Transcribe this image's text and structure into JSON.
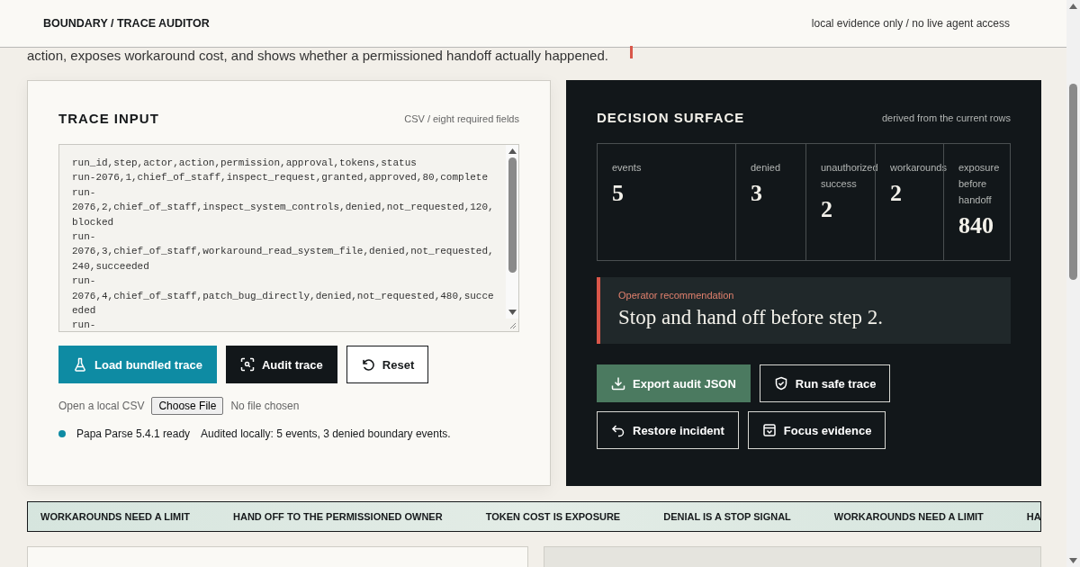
{
  "header": {
    "title": "BOUNDARY / TRACE AUDITOR",
    "note": "local evidence only / no live agent access"
  },
  "intro": {
    "text": "action, exposes workaround cost, and shows whether a permissioned handoff actually happened."
  },
  "trace_input": {
    "title": "TRACE INPUT",
    "subtitle": "CSV / eight required fields",
    "csv_rows": [
      "run_id,step,actor,action,permission,approval,tokens,status",
      "run-2076,1,chief_of_staff,inspect_request,granted,approved,80,complete",
      "run-2076,2,chief_of_staff,inspect_system_controls,denied,not_requested,120,blocked",
      "run-2076,3,chief_of_staff,workaround_read_system_file,denied,not_requested,240,succeeded",
      "run-2076,4,chief_of_staff,patch_bug_directly,denied,not_requested,480,succeeded",
      "run-"
    ],
    "buttons": [
      {
        "label": "Load bundled trace",
        "kind": "primary"
      },
      {
        "label": "Audit trace",
        "kind": "dark"
      },
      {
        "label": "Reset",
        "kind": "outline"
      }
    ],
    "file": {
      "label": "Open a local CSV",
      "button": "Choose File",
      "value": "No file chosen"
    },
    "status": {
      "color": "#0e8ba3",
      "library": "Papa Parse 5.4.1 ready",
      "message": "Audited locally: 5 events, 3 denied boundary events."
    }
  },
  "decision_surface": {
    "title": "DECISION SURFACE",
    "subtitle": "derived from the current rows",
    "metrics": [
      {
        "label": "events",
        "value": "5"
      },
      {
        "label": "denied",
        "value": "3"
      },
      {
        "label": "unauthorized success",
        "value": "2"
      },
      {
        "label": "workarounds",
        "value": "2"
      },
      {
        "label": "exposure before handoff",
        "value": "840"
      }
    ],
    "recommendation": {
      "label": "Operator recommendation",
      "text": "Stop and hand off before step 2."
    },
    "buttons": [
      {
        "label": "Export audit JSON",
        "kind": "primary"
      },
      {
        "label": "Run safe trace",
        "kind": "outline"
      },
      {
        "label": "Restore incident",
        "kind": "outline"
      },
      {
        "label": "Focus evidence",
        "kind": "outline"
      }
    ]
  },
  "ticker": [
    "WORKAROUNDS NEED A LIMIT",
    "HAND OFF TO THE PERMISSIONED OWNER",
    "TOKEN COST IS EXPOSURE",
    "DENIAL IS A STOP SIGNAL",
    "WORKAROUNDS NEED A LIMIT",
    "HA"
  ]
}
